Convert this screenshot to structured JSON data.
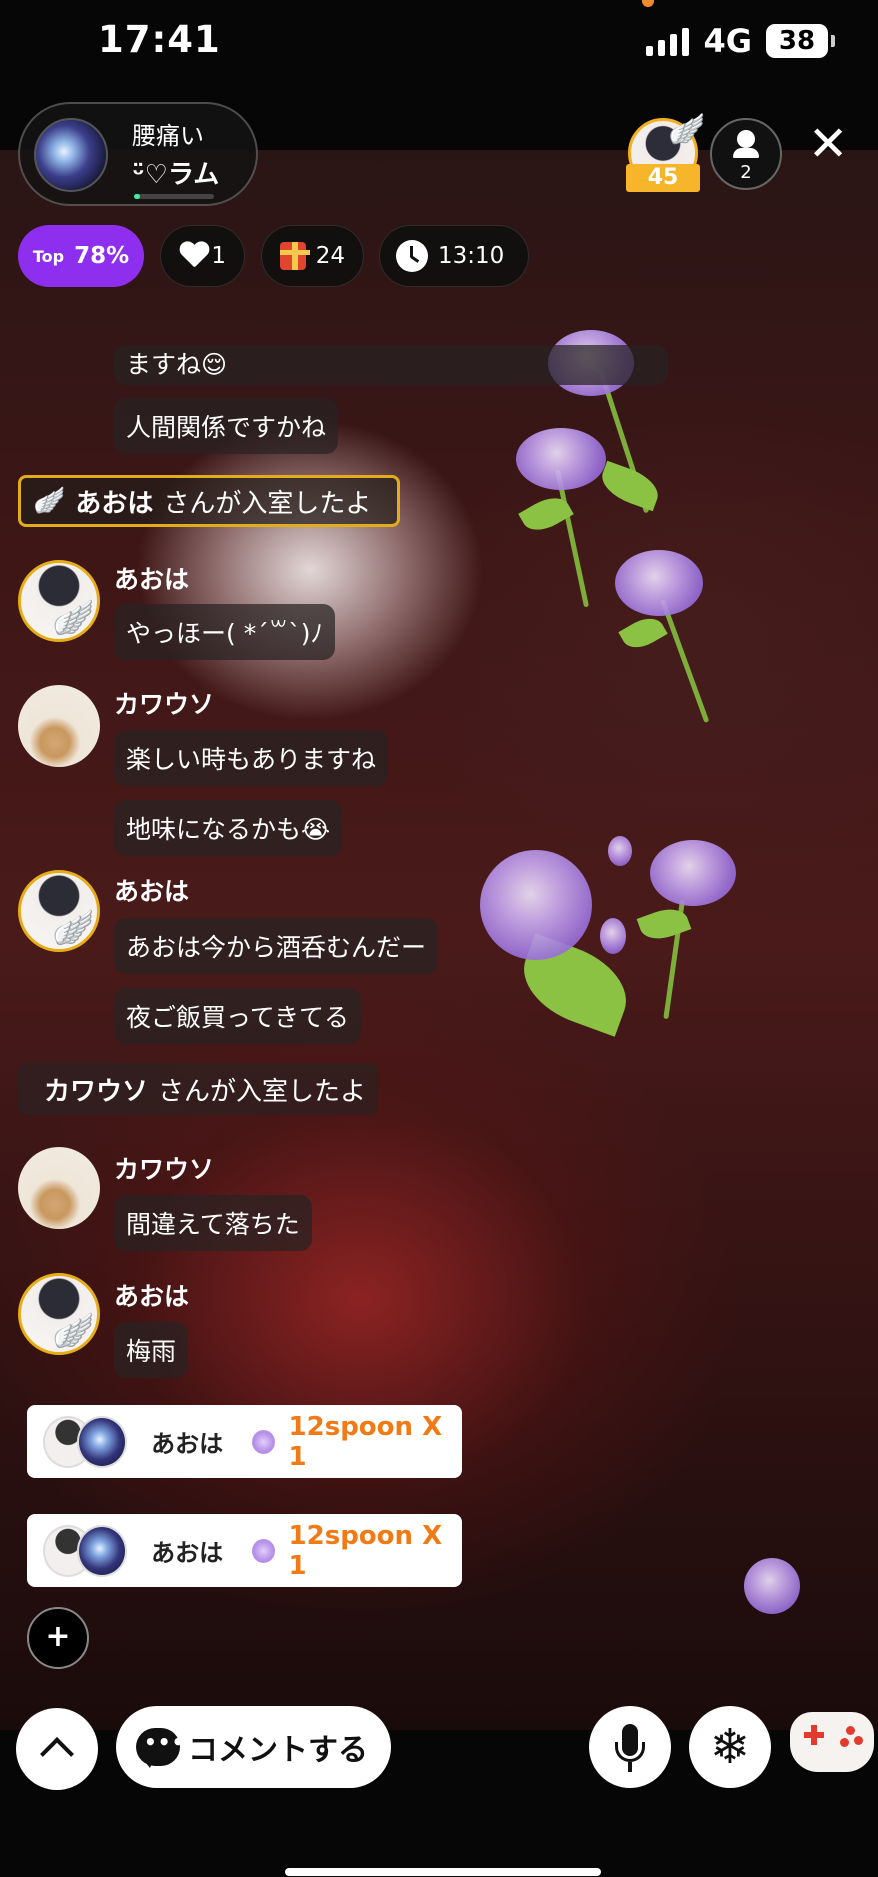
{
  "status": {
    "time": "17:41",
    "network": "4G",
    "battery": "38"
  },
  "room": {
    "title": "腰痛い",
    "subtitle": "ᵕ̈♡ラム"
  },
  "top_listener": {
    "level": "45"
  },
  "viewers": {
    "count": "2"
  },
  "stats": {
    "top_label": "Top",
    "top_value": "78%",
    "likes": "1",
    "gifts": "24",
    "timer": "13:10"
  },
  "chat": {
    "partial": "ますね😌",
    "msg1": "人間関係ですかね",
    "join1": {
      "name": "あおは",
      "suffix": "さんが入室したよ"
    },
    "m2": {
      "name": "あおは",
      "lines": [
        "やっほー( *´꒳`)ﾉ"
      ]
    },
    "m3": {
      "name": "カワウソ",
      "lines": [
        "楽しい時もありますね",
        "地味になるかも😭"
      ]
    },
    "m4": {
      "name": "あおは",
      "lines": [
        "あおは今から酒呑むんだー",
        "夜ご飯買ってきてる"
      ]
    },
    "join2": {
      "name": "カワウソ",
      "suffix": "さんが入室したよ"
    },
    "m5": {
      "name": "カワウソ",
      "lines": [
        "間違えて落ちた"
      ]
    },
    "m6": {
      "name": "あおは",
      "lines": [
        "梅雨"
      ]
    }
  },
  "gifts": [
    {
      "name": "あおは",
      "amount": "12spoon X 1"
    },
    {
      "name": "あおは",
      "amount": "12spoon X 1"
    }
  ],
  "bottom": {
    "plus": "+",
    "comment": "コメントする"
  },
  "icons": [
    "wifi-bars-icon",
    "heart-icon",
    "gift-icon",
    "clock-icon",
    "close-icon",
    "person-icon",
    "wing-icon",
    "chevron-up-icon",
    "chat-bubble-icon",
    "microphone-icon",
    "snowflake-icon",
    "gamepad-icon",
    "rose-icon"
  ],
  "colors": {
    "accent": "#8e2ff0",
    "gold": "#e2ad1c",
    "gift_orange": "#f07a16"
  }
}
